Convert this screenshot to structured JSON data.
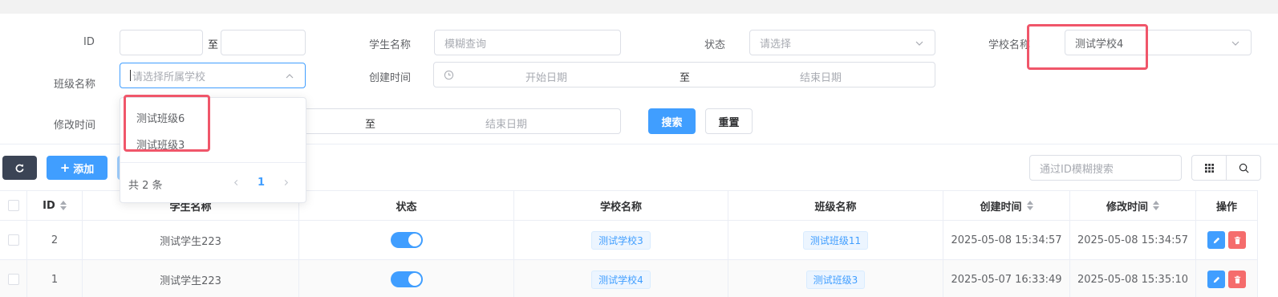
{
  "filters": {
    "id_label": "ID",
    "id_sep": "至",
    "student_name_label": "学生名称",
    "student_name_placeholder": "模糊查询",
    "status_label": "状态",
    "status_placeholder": "请选择",
    "school_name_label": "学校名称",
    "school_name_value": "测试学校4",
    "class_name_label": "班级名称",
    "class_name_placeholder": "请选择所属学校",
    "create_time_label": "创建时间",
    "create_start_placeholder": "开始日期",
    "create_sep": "至",
    "create_end_placeholder": "结束日期",
    "modify_time_label": "修改时间",
    "modify_sep": "至",
    "modify_end_placeholder": "结束日期",
    "search_button": "搜索",
    "reset_button": "重置"
  },
  "dropdown": {
    "items": [
      "测试班级6",
      "测试班级3"
    ],
    "total_text": "共 2 条",
    "current_page": "1"
  },
  "toolbar": {
    "add_button": "添加",
    "search_placeholder": "通过ID模糊搜索"
  },
  "table": {
    "headers": {
      "id": "ID",
      "student_name": "学生名称",
      "status": "状态",
      "school_name": "学校名称",
      "class_name": "班级名称",
      "create_time": "创建时间",
      "modify_time": "修改时间",
      "actions": "操作"
    },
    "rows": [
      {
        "id": "2",
        "student_name": "测试学生223",
        "status_on": true,
        "school": "测试学校3",
        "class": "测试班级11",
        "created": "2025-05-08 15:34:57",
        "modified": "2025-05-08 15:34:57"
      },
      {
        "id": "1",
        "student_name": "测试学生223",
        "status_on": true,
        "school": "测试学校4",
        "class": "测试班级3",
        "created": "2025-05-07 16:33:49",
        "modified": "2025-05-08 15:35:10"
      }
    ]
  },
  "colors": {
    "primary": "#409eff",
    "danger": "#f56c6c",
    "highlight": "#f0566a",
    "dark_button": "#3b4455"
  }
}
